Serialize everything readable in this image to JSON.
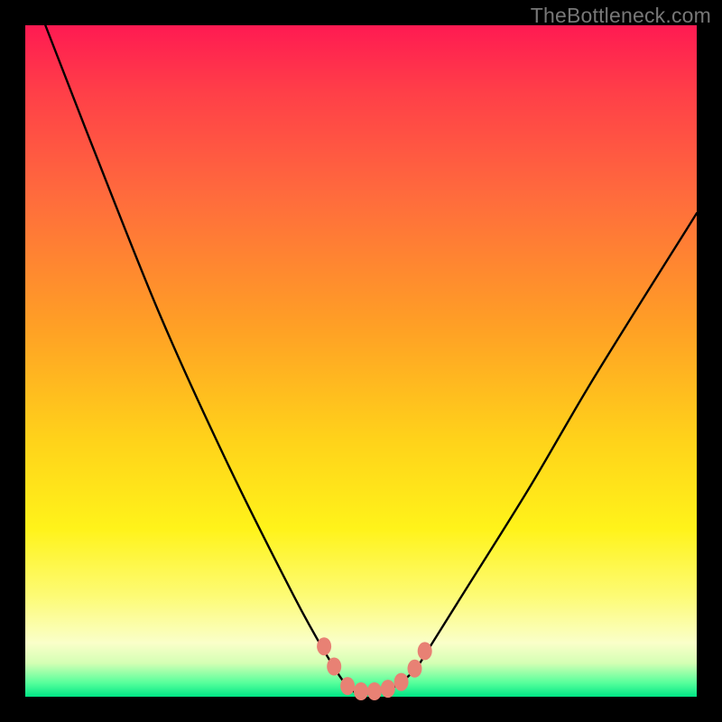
{
  "watermark": "TheBottleneck.com",
  "chart_data": {
    "type": "line",
    "title": "",
    "xlabel": "",
    "ylabel": "",
    "xlim": [
      0,
      100
    ],
    "ylim": [
      0,
      100
    ],
    "series": [
      {
        "name": "bottleneck-curve",
        "x": [
          3,
          10,
          20,
          30,
          40,
          45,
          48,
          50,
          52,
          55,
          58,
          60,
          65,
          75,
          85,
          100
        ],
        "y": [
          100,
          82,
          57,
          35,
          15,
          6,
          1.5,
          0.5,
          0.5,
          1.5,
          4,
          7,
          15,
          31,
          48,
          72
        ]
      }
    ],
    "markers": {
      "name": "highlight-beads",
      "color": "#e88174",
      "points": [
        {
          "x": 44.5,
          "y": 7.5
        },
        {
          "x": 46.0,
          "y": 4.5
        },
        {
          "x": 48.0,
          "y": 1.6
        },
        {
          "x": 50.0,
          "y": 0.8
        },
        {
          "x": 52.0,
          "y": 0.8
        },
        {
          "x": 54.0,
          "y": 1.2
        },
        {
          "x": 56.0,
          "y": 2.2
        },
        {
          "x": 58.0,
          "y": 4.2
        },
        {
          "x": 59.5,
          "y": 6.8
        }
      ]
    },
    "gradient_stops": [
      {
        "pos": 0,
        "color": "#ff1a52"
      },
      {
        "pos": 25,
        "color": "#ff6a3d"
      },
      {
        "pos": 62,
        "color": "#ffd31a"
      },
      {
        "pos": 92,
        "color": "#faffc9"
      },
      {
        "pos": 100,
        "color": "#00e585"
      }
    ]
  }
}
